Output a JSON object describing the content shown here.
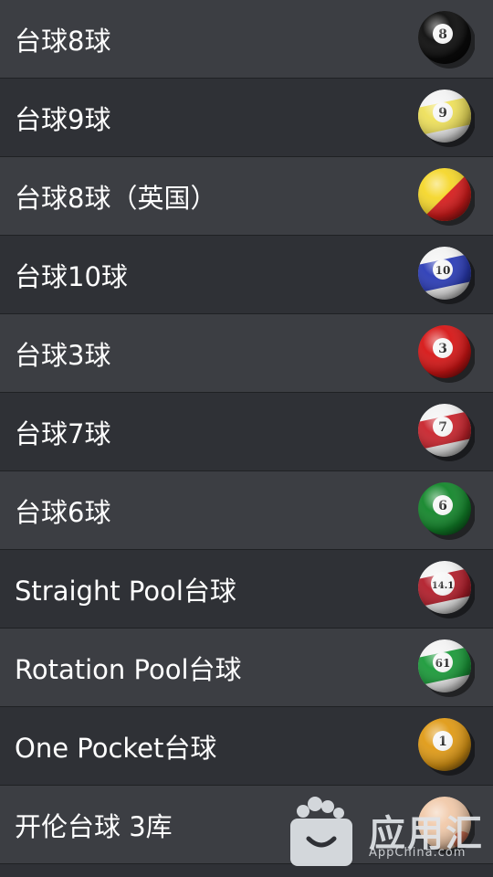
{
  "items": [
    {
      "label": "台球8球",
      "ball": {
        "base": "#0b0b0b",
        "stripe": null,
        "number": "8",
        "split": null
      }
    },
    {
      "label": "台球9球",
      "ball": {
        "base": "#f2f2f2",
        "stripe": "#eee05a",
        "number": "9",
        "split": null
      }
    },
    {
      "label": "台球8球（英国）",
      "ball": {
        "base": "#f5d72a",
        "stripe": null,
        "number": "",
        "split": "#d81c1c"
      }
    },
    {
      "label": "台球10球",
      "ball": {
        "base": "#f2f2f2",
        "stripe": "#2a3bb6",
        "number": "10",
        "split": null
      }
    },
    {
      "label": "台球3球",
      "ball": {
        "base": "#d61515",
        "stripe": null,
        "number": "3",
        "split": null
      }
    },
    {
      "label": "台球7球",
      "ball": {
        "base": "#f2f2f2",
        "stripe": "#c9232c",
        "number": "7",
        "split": null
      }
    },
    {
      "label": "台球6球",
      "ball": {
        "base": "#12862a",
        "stripe": null,
        "number": "6",
        "split": null
      }
    },
    {
      "label": "Straight Pool台球",
      "ball": {
        "base": "#f2f2f2",
        "stripe": "#b21d2a",
        "number": "14.1",
        "split": null
      }
    },
    {
      "label": "Rotation Pool台球",
      "ball": {
        "base": "#f2f2f2",
        "stripe": "#1a9a39",
        "number": "61",
        "split": null
      }
    },
    {
      "label": "One Pocket台球",
      "ball": {
        "base": "#e09a15",
        "stripe": null,
        "number": "1",
        "split": null
      }
    },
    {
      "label": "开伦台球 3库",
      "ball": {
        "base": "#f1c9a9",
        "stripe": null,
        "number": "",
        "split": null
      }
    }
  ],
  "watermark": {
    "text": "应用汇",
    "sub": "AppChina.com"
  }
}
